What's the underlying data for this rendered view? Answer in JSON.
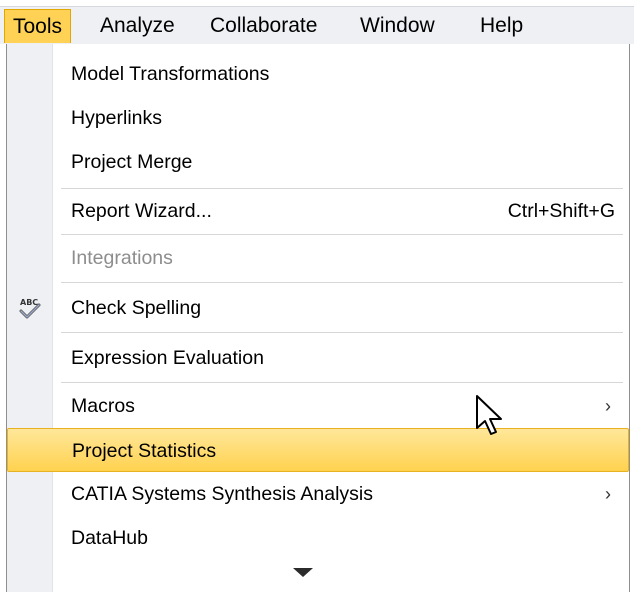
{
  "menubar": {
    "items": [
      {
        "label": "Tools",
        "active": true
      },
      {
        "label": "Analyze"
      },
      {
        "label": "Collaborate"
      },
      {
        "label": "Window"
      },
      {
        "label": "Help"
      }
    ]
  },
  "tools_menu": {
    "items": [
      {
        "label": "Model Transformations"
      },
      {
        "label": "Hyperlinks"
      },
      {
        "label": "Project Merge"
      },
      {
        "label": "Report Wizard...",
        "shortcut": "Ctrl+Shift+G"
      },
      {
        "label": "Integrations",
        "disabled": true
      },
      {
        "label": "Check Spelling",
        "icon": "spell-check-icon"
      },
      {
        "label": "Expression Evaluation"
      },
      {
        "label": "Macros",
        "submenu": true
      },
      {
        "label": "Project Statistics",
        "highlighted": true
      },
      {
        "label": "CATIA Systems Synthesis Analysis",
        "submenu": true
      },
      {
        "label": "DataHub"
      }
    ],
    "submenu_arrow": "›",
    "scroll_indicator": "scroll-down-arrow"
  },
  "colors": {
    "menubar_bg": "#eef0f4",
    "active_bg": "#ffd256",
    "highlight_bg": "#ffd24f",
    "disabled_text": "#8d8d8d"
  }
}
